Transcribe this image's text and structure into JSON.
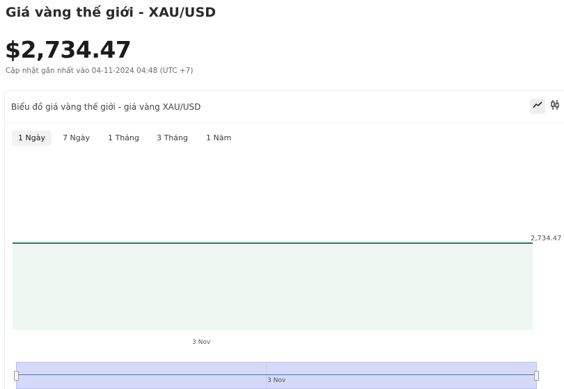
{
  "header": {
    "title": "Giá vàng thế giới - XAU/USD",
    "price": "$2,734.47",
    "updated": "Cập nhật gần nhất vào 04-11-2024 04:48 (UTC +7)"
  },
  "chart_card": {
    "title": "Biểu đồ giá vàng thế giới - giá vàng XAU/USD",
    "type_buttons": [
      {
        "icon": "line-chart-icon",
        "active": true
      },
      {
        "icon": "candlestick-chart-icon",
        "active": false
      }
    ],
    "tabs": [
      {
        "label": "1 Ngày",
        "active": true
      },
      {
        "label": "7 Ngày",
        "active": false
      },
      {
        "label": "1 Tháng",
        "active": false
      },
      {
        "label": "3 Tháng",
        "active": false
      },
      {
        "label": "1 Năm",
        "active": false
      }
    ],
    "price_label": "2,734.47",
    "x_tick": "3 Nov",
    "navigator_label": "3 Nov"
  },
  "colors": {
    "line": "#1b7a6e",
    "area": "#eef6f2",
    "navigator_fill": "#d4daf8"
  },
  "chart_data": {
    "type": "area",
    "x": [
      "3 Nov"
    ],
    "series": [
      {
        "values": [
          2734.47
        ]
      }
    ],
    "last_value_label": "2,734.47",
    "grid": false
  }
}
